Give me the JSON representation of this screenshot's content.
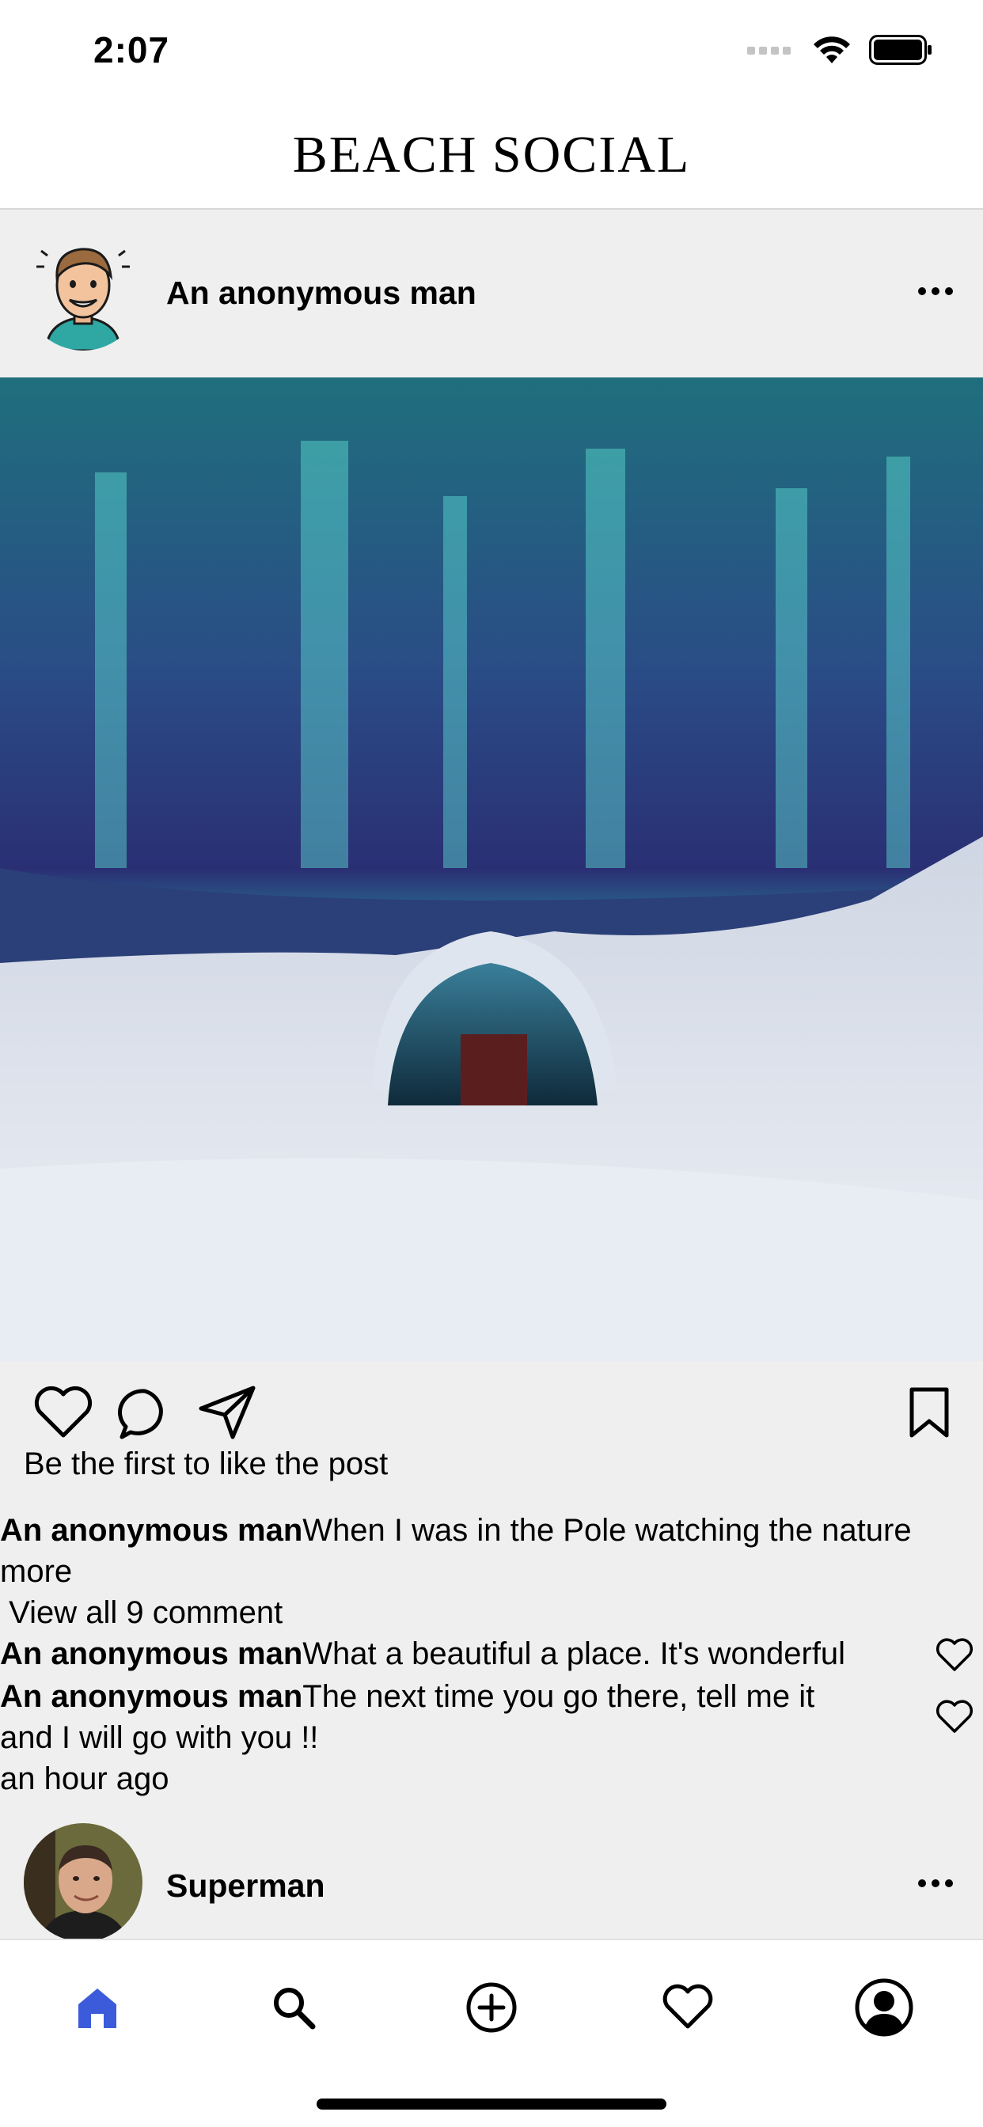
{
  "status_bar": {
    "time": "2:07"
  },
  "app": {
    "title": "BEACH SOCIAL"
  },
  "post1": {
    "author": "An anonymous man",
    "likes_text": "Be the first to like the post",
    "caption": {
      "author": "An anonymous man",
      "text": "When I was in the Pole watching the nature",
      "more_label": "more"
    },
    "view_comments": " View all 9 comment",
    "comments": [
      {
        "author": "An anonymous man",
        "text": "What a beautiful a place. It's wonderful"
      },
      {
        "author": "An anonymous man",
        "text": "The next time you go there, tell me it",
        "text_cont": "and I will go with you !!"
      }
    ],
    "timestamp": "an hour ago"
  },
  "post2": {
    "author": "Superman"
  },
  "tab_bar": {
    "items": [
      "home",
      "search",
      "add",
      "activity",
      "profile"
    ],
    "active": "home",
    "active_color": "#3b5bdb"
  }
}
